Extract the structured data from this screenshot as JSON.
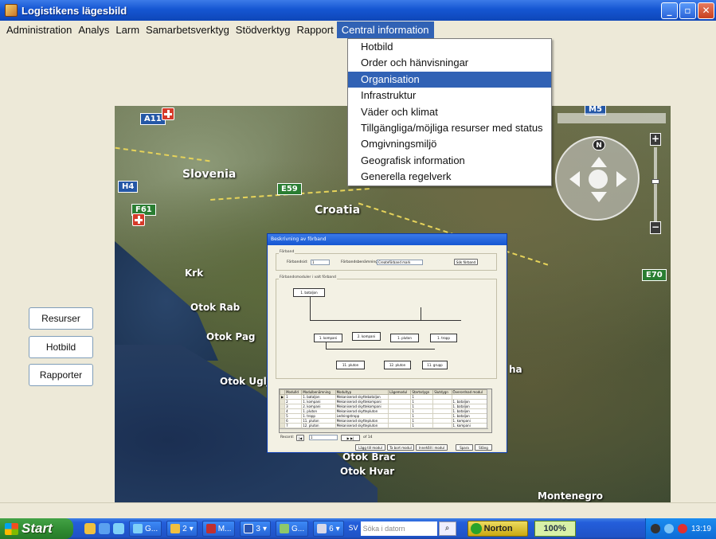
{
  "window": {
    "title": "Logistikens lägesbild",
    "buttons": [
      "_",
      "▫",
      "✕"
    ]
  },
  "menubar": {
    "items": [
      "Administration",
      "Analys",
      "Larm",
      "Samarbetsverktyg",
      "Stödverktyg",
      "Rapport",
      "Central information"
    ],
    "active": "Central information"
  },
  "dropdown": {
    "items": [
      "Hotbild",
      "Order och hänvisningar",
      "Organisation",
      "Infrastruktur",
      "Väder och klimat",
      "Tillgängliga/möjliga resurser med status",
      "Omgivningsmiljö",
      "Geografisk information",
      "Generella regelverk"
    ],
    "selected": "Organisation"
  },
  "side_buttons": [
    "Resurser",
    "Hotbild",
    "Rapporter"
  ],
  "map": {
    "labels": {
      "slovenia": "Slovenia",
      "croatia": "Croatia",
      "krk": "Krk",
      "otok_rab": "Otok Rab",
      "otok_pag": "Otok Pag",
      "otok_ugljan": "Otok Uglja",
      "otok_brac": "Otok Brac",
      "otok_hvar": "Otok Hvar",
      "montenegro": "Montenegro",
      "ha": "ha"
    },
    "roads": {
      "a11": "A11",
      "h4": "H4",
      "e59": "E59",
      "f61": "F61",
      "m5": "M5",
      "e70": "E70"
    },
    "compass_n": "N",
    "zoom_in": "+",
    "zoom_out": "−"
  },
  "dialog": {
    "title": "Beskrivning av förband",
    "section_forband": "Förband",
    "forband_id_label": "Förbandsid:",
    "forband_id_value": "1",
    "forband_name_label": "Förbandsbenämning:",
    "forband_name_value": "Createförband mark",
    "search_button": "Sök förband",
    "section_modules": "Förbandsmoduler i valt förband",
    "org": {
      "root": "1. bataljon",
      "level2": [
        "1. kompani",
        "2. kompani",
        "1. pluton",
        "1. tropp"
      ],
      "level3": [
        "11. pluton",
        "12. pluton",
        "11. grupp"
      ]
    },
    "grid": {
      "headers": [
        "ModulId",
        "Modulbenämning",
        "Modultyp",
        "Lägemodul",
        "Startsdygn",
        "Slutdygn",
        "Överordnad modul"
      ],
      "rows": [
        [
          "1",
          "1. bataljon",
          "Mekaniserad skyttebataljon",
          "",
          "1",
          "",
          ""
        ],
        [
          "2",
          "1. kompani",
          "Mekaniserad skyttekompani",
          "",
          "1",
          "",
          "1. bataljon"
        ],
        [
          "3",
          "2. kompani",
          "Mekaniserad skyttekompani",
          "",
          "1",
          "",
          "1. bataljon"
        ],
        [
          "4",
          "1. pluton",
          "Mekaniserad skyttepluton",
          "",
          "1",
          "",
          "1. bataljon"
        ],
        [
          "5",
          "1. tropp",
          "Ledningstropp",
          "",
          "1",
          "",
          "1. bataljon"
        ],
        [
          "6",
          "11. pluton",
          "Mekaniserad skyttepluton",
          "",
          "1",
          "",
          "1. kompani"
        ],
        [
          "7",
          "12. pluton",
          "Mekaniserad skyttepluton",
          "",
          "1",
          "",
          "1. kompani"
        ]
      ]
    },
    "record_label": "Record:",
    "record_value": "1",
    "record_of": "of 14",
    "buttons": [
      "Lägg till modul",
      "Ta bort modul",
      "Innehåll i modul",
      "Spara",
      "Stäng"
    ]
  },
  "taskbar": {
    "start": "Start",
    "tasks": [
      "G...",
      "2",
      "M...",
      "3",
      "G...",
      "6"
    ],
    "lang": "SV",
    "search_placeholder": "Söka i datorn",
    "norton": "Norton",
    "percent": "100%",
    "clock": "13:19"
  }
}
